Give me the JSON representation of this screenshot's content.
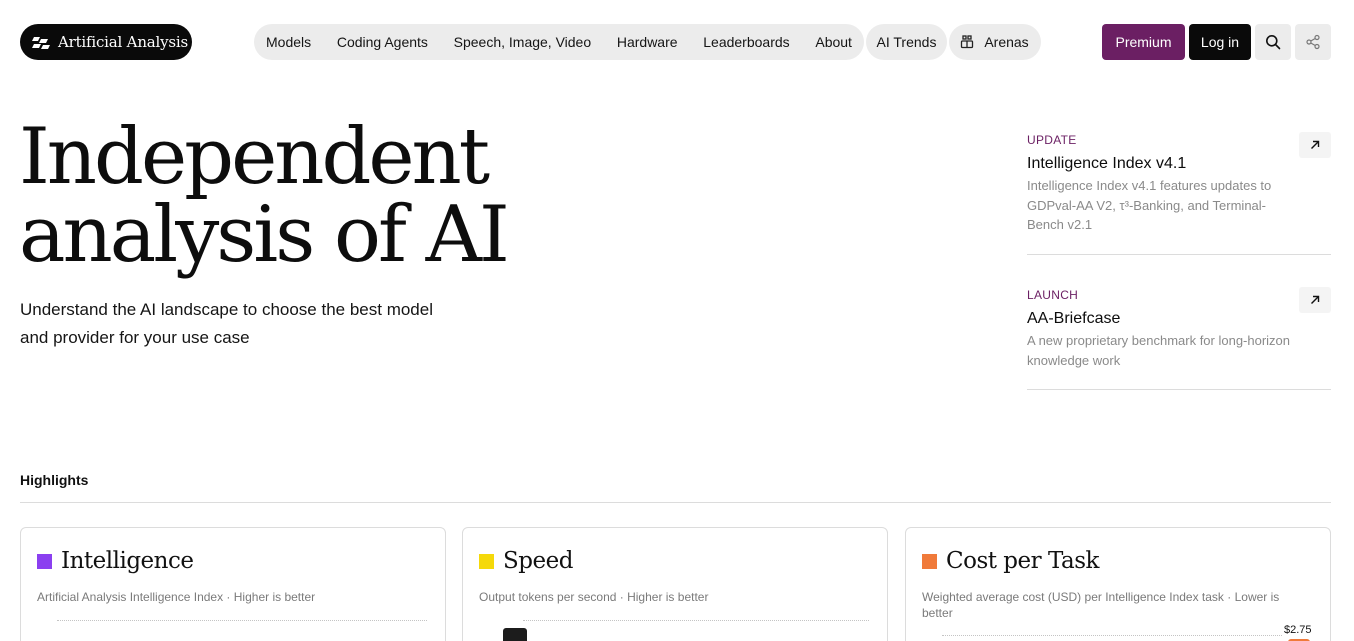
{
  "header": {
    "logo_text": "Artificial Analysis",
    "nav": [
      {
        "label": "Models"
      },
      {
        "label": "Coding Agents"
      },
      {
        "label": "Speech, Image, Video"
      },
      {
        "label": "Hardware"
      },
      {
        "label": "Leaderboards"
      },
      {
        "label": "About"
      }
    ],
    "nav_trends": "AI Trends",
    "nav_arenas": "Arenas",
    "premium_label": "Premium",
    "login_label": "Log in",
    "icons": {
      "search": "search-icon",
      "share": "share-icon",
      "arenas": "arena-icon",
      "logo": "logo-mark-icon"
    }
  },
  "hero": {
    "title_line1": "Independent",
    "title_line2": "analysis of AI",
    "subtitle": "Understand the AI landscape to choose the best model and provider for your use case"
  },
  "news": [
    {
      "tag": "UPDATE",
      "title": "Intelligence Index v4.1",
      "description": "Intelligence Index v4.1 features updates to GDPval-AA V2, τ³-Banking, and Terminal-Bench v2.1"
    },
    {
      "tag": "LAUNCH",
      "title": "AA-Briefcase",
      "description": "A new proprietary benchmark for long-horizon knowledge work"
    }
  ],
  "highlights": {
    "label": "Highlights",
    "cards": [
      {
        "title": "Intelligence",
        "subtitle": "Artificial Analysis Intelligence Index · Higher is better",
        "color": "#8b3ff0"
      },
      {
        "title": "Speed",
        "subtitle": "Output tokens per second · Higher is better",
        "color": "#f5d90a"
      },
      {
        "title": "Cost per Task",
        "subtitle": "Weighted average cost (USD) per Intelligence Index task · Lower is better",
        "color": "#f07a3a",
        "top_value_label": "$2.75"
      }
    ]
  },
  "colors": {
    "accent": "#6b1f63",
    "dark": "#0a0a0a",
    "pill": "#ececec"
  }
}
